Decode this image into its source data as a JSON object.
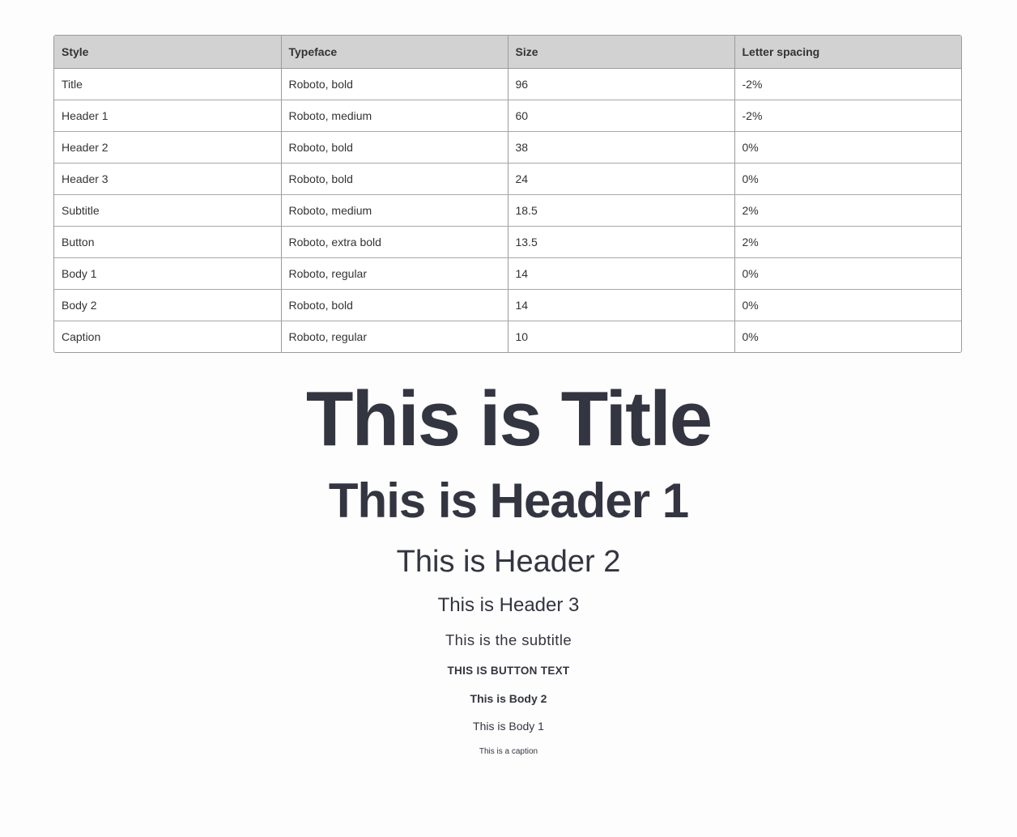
{
  "table": {
    "headers": [
      "Style",
      "Typeface",
      "Size",
      "Letter spacing"
    ],
    "rows": [
      [
        "Title",
        "Roboto, bold",
        "96",
        "-2%"
      ],
      [
        "Header 1",
        "Roboto, medium",
        "60",
        "-2%"
      ],
      [
        "Header 2",
        "Roboto, bold",
        "38",
        "0%"
      ],
      [
        "Header 3",
        "Roboto, bold",
        "24",
        "0%"
      ],
      [
        "Subtitle",
        "Roboto, medium",
        "18.5",
        "2%"
      ],
      [
        "Button",
        "Roboto, extra bold",
        "13.5",
        "2%"
      ],
      [
        "Body 1",
        "Roboto, regular",
        "14",
        "0%"
      ],
      [
        "Body 2",
        "Roboto, bold",
        "14",
        "0%"
      ],
      [
        "Caption",
        "Roboto, regular",
        "10",
        "0%"
      ]
    ]
  },
  "specimens": {
    "title": "This is Title",
    "header1": "This is Header 1",
    "header2": "This is Header 2",
    "header3": "This is Header 3",
    "subtitle": "This is the subtitle",
    "button": "THIS IS BUTTON TEXT",
    "body2": "This is Body 2",
    "body1": "This is Body 1",
    "caption": "This is a caption"
  },
  "colors": {
    "text": "#333541",
    "header_bg": "#d2d2d2",
    "border": "#9b9b9b"
  }
}
